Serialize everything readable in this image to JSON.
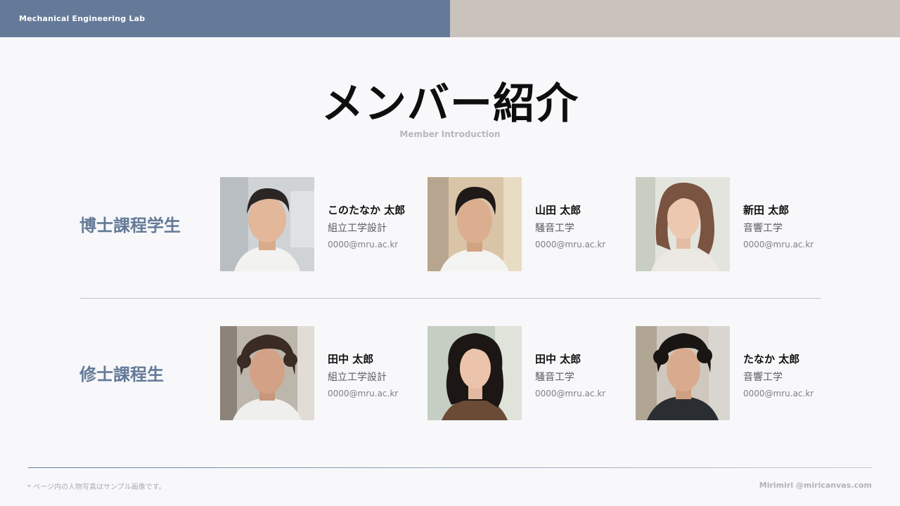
{
  "header": {
    "lab_name": "Mechanical Engineering Lab"
  },
  "title": "メンバー紹介",
  "subtitle": "Member Introduction",
  "groups": [
    {
      "label": "博士課程学生",
      "members": [
        {
          "name": "このたなか 太郎",
          "department": "組立工学設計",
          "email": "0000@mru.ac.kr"
        },
        {
          "name": "山田 太郎",
          "department": "騒音工学",
          "email": "0000@mru.ac.kr"
        },
        {
          "name": "新田 太郎",
          "department": "音響工学",
          "email": "0000@mru.ac.kr"
        }
      ]
    },
    {
      "label": "修士課程生",
      "members": [
        {
          "name": "田中 太郎",
          "department": "組立工学設計",
          "email": "0000@mru.ac.kr"
        },
        {
          "name": "田中 太郎",
          "department": "騒音工学",
          "email": "0000@mru.ac.kr"
        },
        {
          "name": "たなか 太郎",
          "department": "音響工学",
          "email": "0000@mru.ac.kr"
        }
      ]
    }
  ],
  "footer": {
    "note": "* ページ内の人物写真はサンプル画像です。",
    "credit": "Mirimiri @miricanvas.com"
  },
  "colors": {
    "accent": "#647a98",
    "header_right": "#c9c2bd",
    "background": "#f8f8fa"
  }
}
